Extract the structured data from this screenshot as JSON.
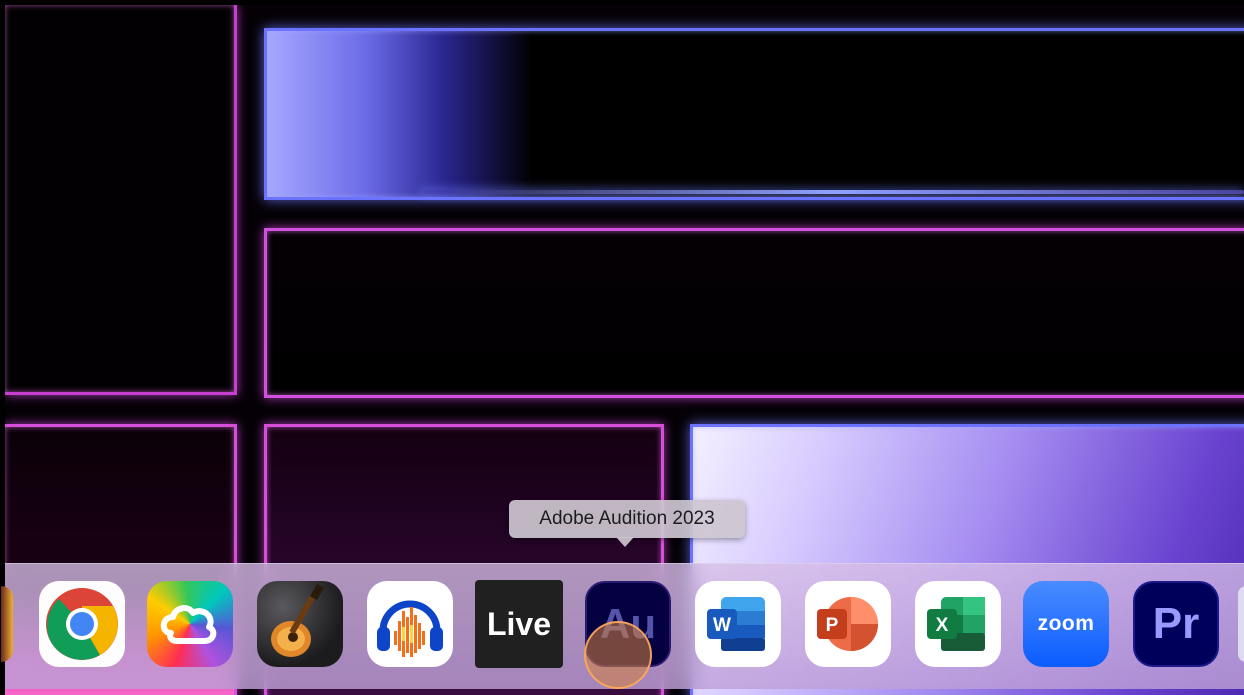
{
  "tooltip": {
    "text": "Adobe Audition 2023"
  },
  "dock": {
    "items": [
      {
        "name": "Google Chrome",
        "icon": "chrome-icon"
      },
      {
        "name": "Creative Cloud",
        "icon": "creative-cloud-icon"
      },
      {
        "name": "GarageBand",
        "icon": "garageband-guitar-icon"
      },
      {
        "name": "Audacity",
        "icon": "audacity-headphones-icon"
      },
      {
        "name": "Ableton Live",
        "icon": "ableton-live-icon",
        "label": "Live"
      },
      {
        "name": "Adobe Audition 2023",
        "icon": "adobe-audition-icon",
        "label": "Au"
      },
      {
        "name": "Microsoft Word",
        "icon": "word-icon",
        "label": "W"
      },
      {
        "name": "Microsoft PowerPoint",
        "icon": "powerpoint-icon",
        "label": "P"
      },
      {
        "name": "Microsoft Excel",
        "icon": "excel-icon",
        "label": "X"
      },
      {
        "name": "Zoom",
        "icon": "zoom-icon",
        "label": "zoom"
      },
      {
        "name": "Adobe Premiere Pro",
        "icon": "premiere-pro-icon",
        "label": "Pr"
      }
    ]
  },
  "colors": {
    "wallpaper_pink": "#d64fd8",
    "wallpaper_blue": "#6a72ff",
    "audition_bg": "#050040",
    "premiere_bg": "#00005b",
    "zoom_blue": "#0b5cff",
    "click_indicator": "#d2823c"
  }
}
